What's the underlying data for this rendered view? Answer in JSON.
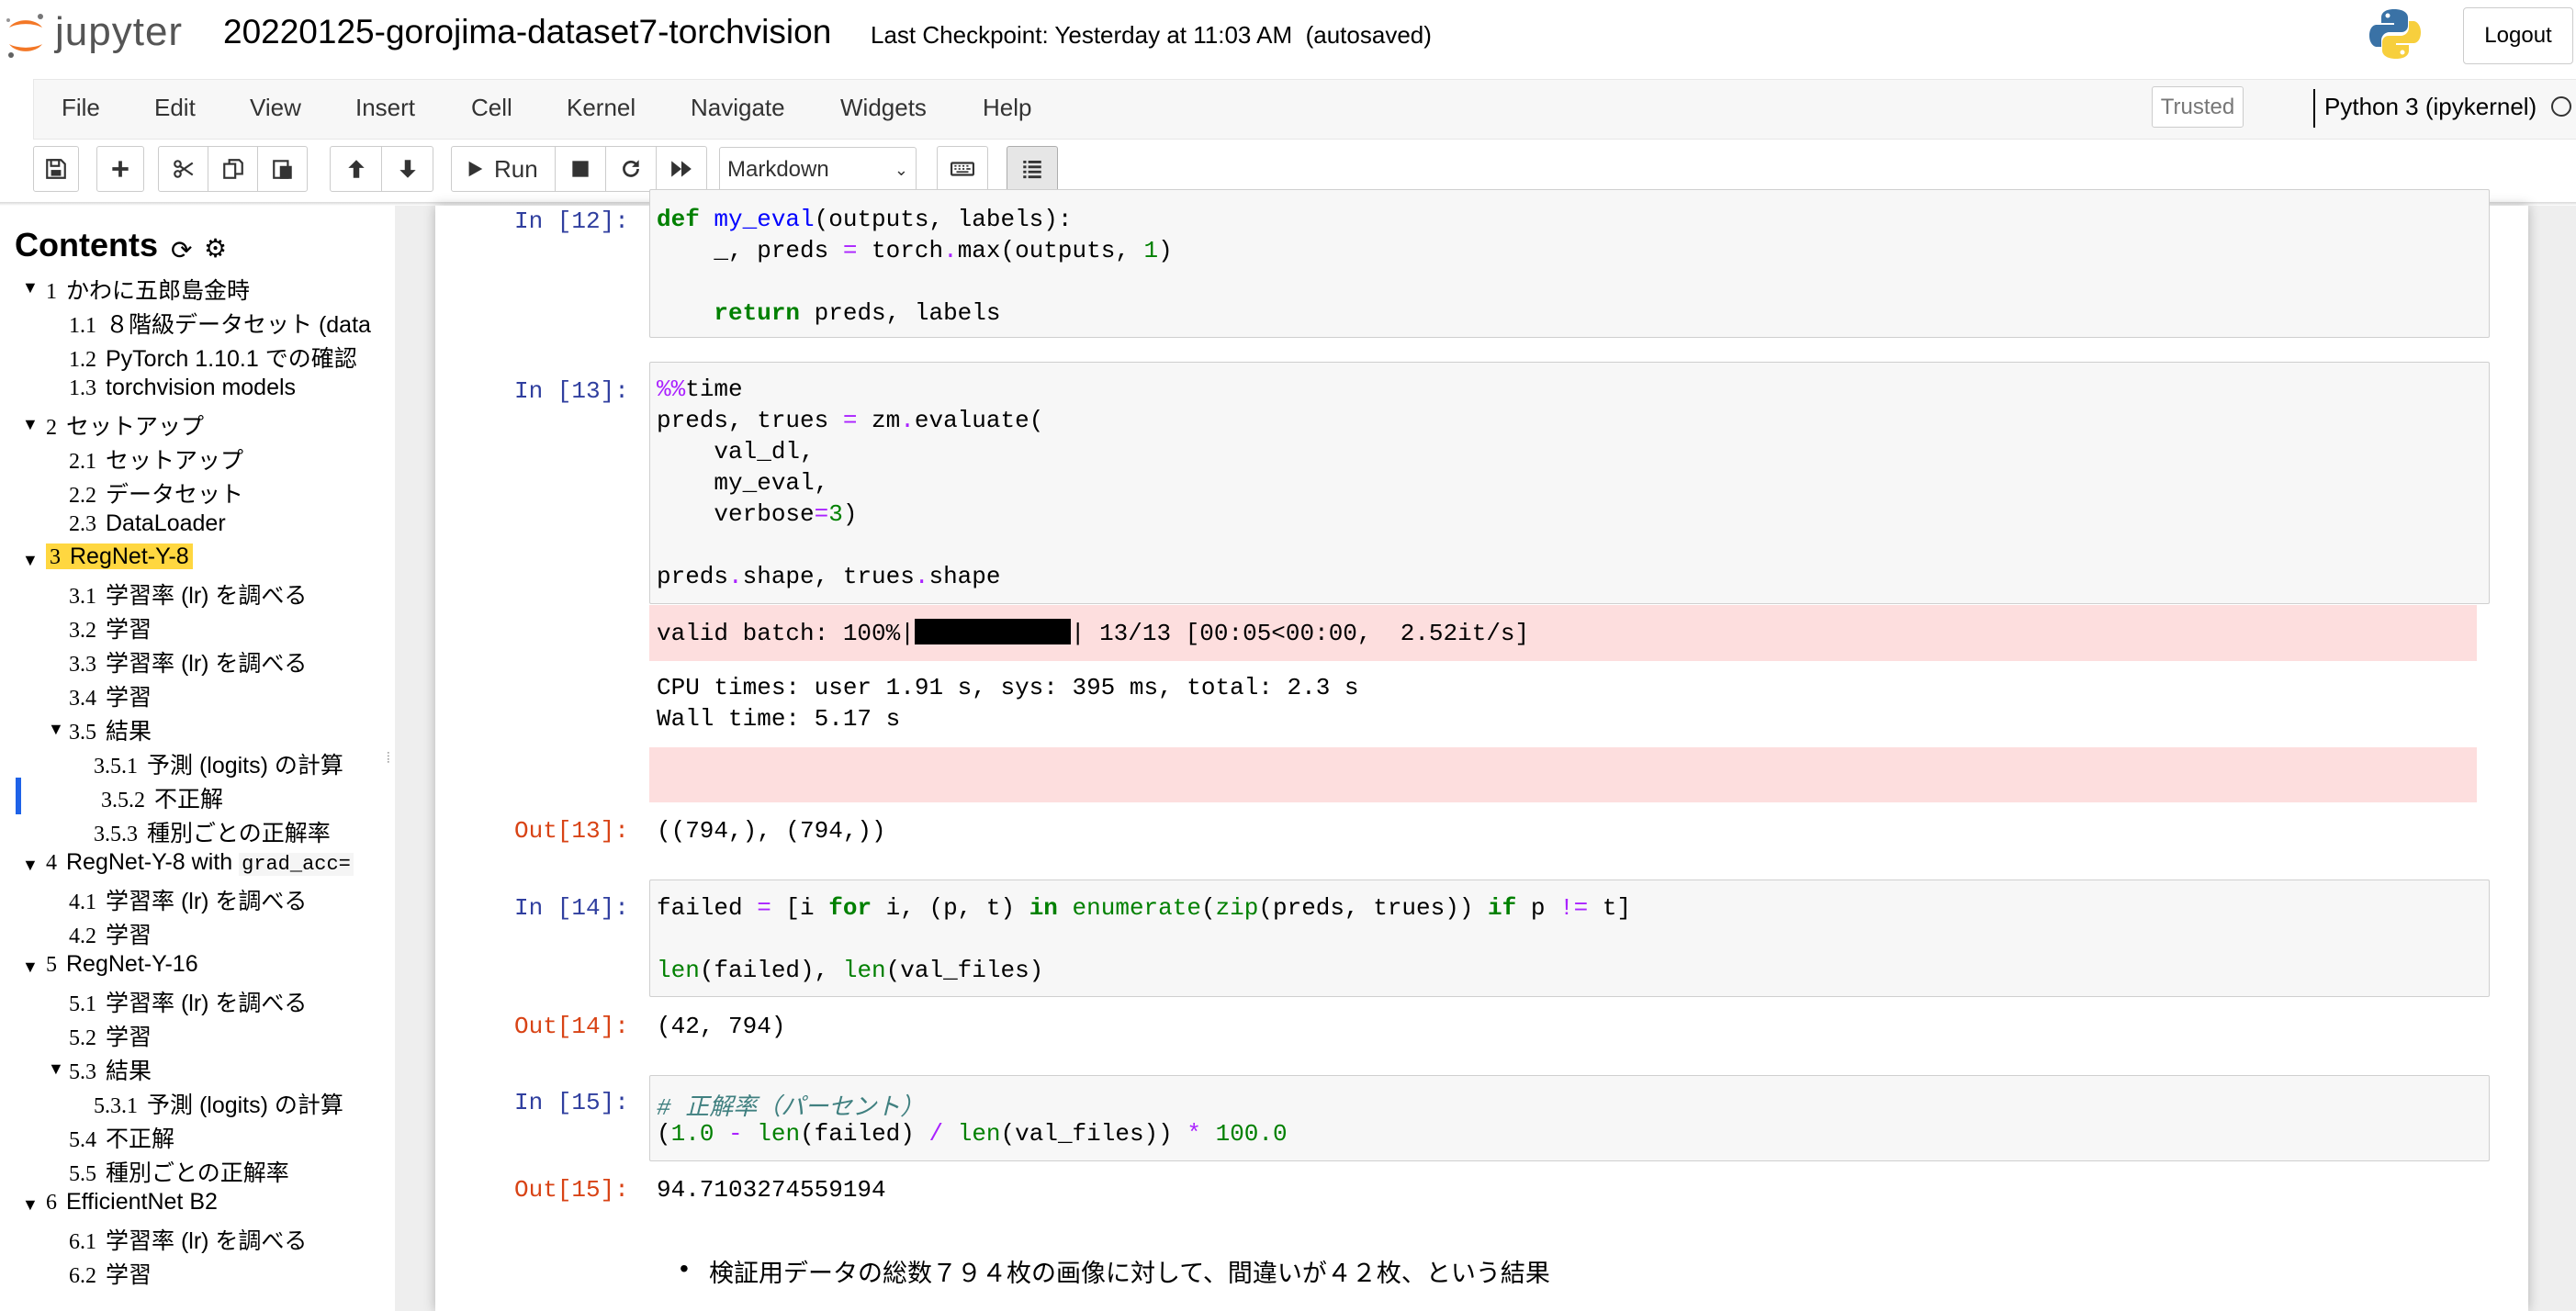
{
  "header": {
    "logo_text": "jupyter",
    "notebook_title": "20220125-gorojima-dataset7-torchvision",
    "checkpoint": "Last Checkpoint: Yesterday at 11:03 AM  (autosaved)",
    "logout_label": "Logout"
  },
  "menubar": {
    "items": [
      "File",
      "Edit",
      "View",
      "Insert",
      "Cell",
      "Kernel",
      "Navigate",
      "Widgets",
      "Help"
    ],
    "trusted": "Trusted",
    "kernel": "Python 3 (ipykernel)"
  },
  "toolbar": {
    "run_label": "Run",
    "cell_type": "Markdown"
  },
  "toc": {
    "title": "Contents",
    "items": [
      {
        "num": "1",
        "text": "かわに五郎島金時"
      },
      {
        "num": "1.1",
        "text": "８階級データセット (data"
      },
      {
        "num": "1.2",
        "text": "PyTorch 1.10.1 での確認"
      },
      {
        "num": "1.3",
        "text": "torchvision models"
      },
      {
        "num": "2",
        "text": "セットアップ"
      },
      {
        "num": "2.1",
        "text": "セットアップ"
      },
      {
        "num": "2.2",
        "text": "データセット"
      },
      {
        "num": "2.3",
        "text": "DataLoader"
      },
      {
        "num": "3",
        "text": "RegNet-Y-8"
      },
      {
        "num": "3.1",
        "text": "学習率 (lr) を調べる"
      },
      {
        "num": "3.2",
        "text": "学習"
      },
      {
        "num": "3.3",
        "text": "学習率 (lr) を調べる"
      },
      {
        "num": "3.4",
        "text": "学習"
      },
      {
        "num": "3.5",
        "text": "結果"
      },
      {
        "num": "3.5.1",
        "text": "予測 (logits) の計算"
      },
      {
        "num": "3.5.2",
        "text": "不正解"
      },
      {
        "num": "3.5.3",
        "text": "種別ごとの正解率"
      },
      {
        "num": "4",
        "text": "RegNet-Y-8 with",
        "code": "grad_acc="
      },
      {
        "num": "4.1",
        "text": "学習率 (lr) を調べる"
      },
      {
        "num": "4.2",
        "text": "学習"
      },
      {
        "num": "5",
        "text": "RegNet-Y-16"
      },
      {
        "num": "5.1",
        "text": "学習率 (lr) を調べる"
      },
      {
        "num": "5.2",
        "text": "学習"
      },
      {
        "num": "5.3",
        "text": "結果"
      },
      {
        "num": "5.3.1",
        "text": "予測 (logits) の計算"
      },
      {
        "num": "5.4",
        "text": "不正解"
      },
      {
        "num": "5.5",
        "text": "種別ごとの正解率"
      },
      {
        "num": "6",
        "text": "EfficientNet B2"
      },
      {
        "num": "6.1",
        "text": "学習率 (lr) を調べる"
      },
      {
        "num": "6.2",
        "text": "学習"
      }
    ]
  },
  "cells": {
    "c12": {
      "prompt": "In [12]:"
    },
    "c13": {
      "prompt": "In [13]:",
      "progress_prefix": "valid batch: 100%|",
      "progress_suffix": "| 13/13 [00:05<00:00,  2.52it/s]",
      "progress_fraction": 1.0,
      "stdout1": "CPU times: user 1.91 s, sys: 395 ms, total: 2.3 s",
      "stdout2": "Wall time: 5.17 s",
      "out_prompt": "Out[13]:",
      "out": "((794,), (794,))"
    },
    "c14": {
      "prompt": "In [14]:",
      "out_prompt": "Out[14]:",
      "out": "(42, 794)"
    },
    "c15": {
      "prompt": "In [15]:",
      "out_prompt": "Out[15]:",
      "out": "94.7103274559194"
    },
    "markdown_bullet": "検証用データの総数７９４枚の画像に対して、間違いが４２枚、という結果"
  }
}
